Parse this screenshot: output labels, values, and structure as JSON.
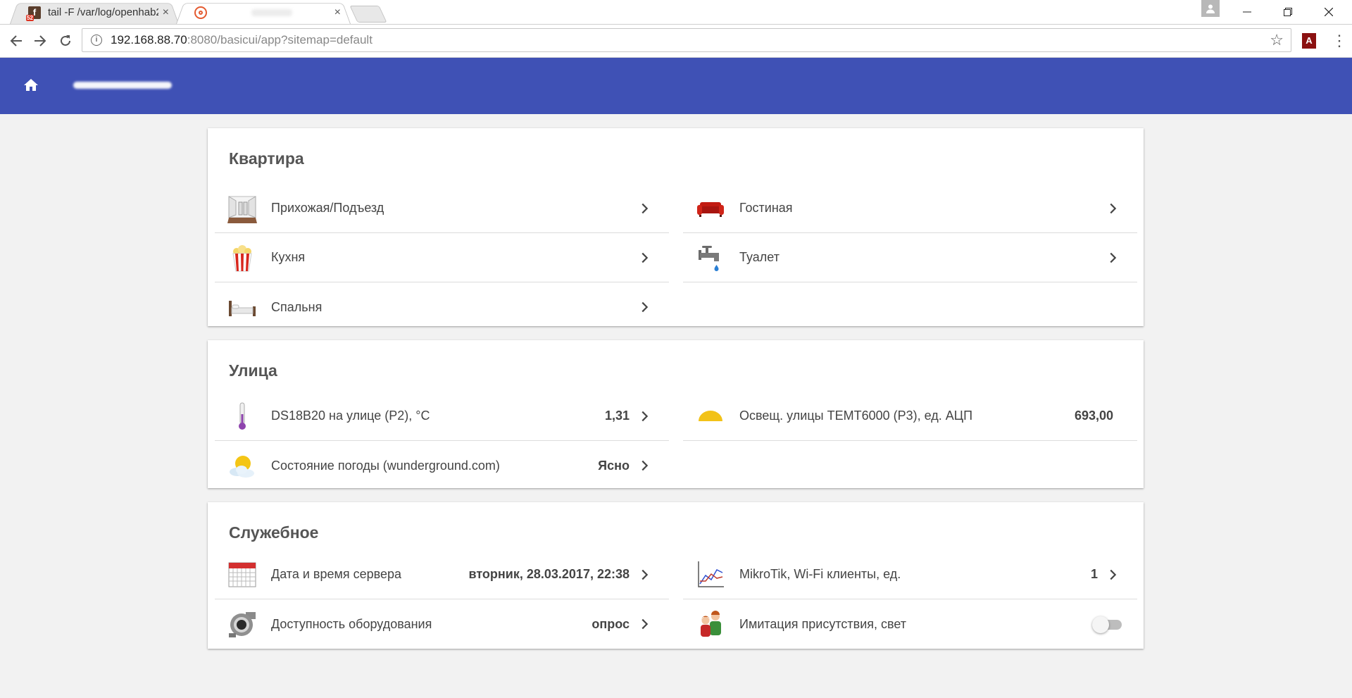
{
  "browser": {
    "tabs": [
      {
        "title": "tail -F /var/log/openhab2",
        "favicon": "terminal-f-icon",
        "close": "×"
      },
      {
        "title": "",
        "favicon": "openhab-icon",
        "close": "×"
      }
    ],
    "profile_icon": "person-icon",
    "window_controls": {
      "minimize": "—",
      "restore": "❐",
      "close": "✕"
    },
    "url": {
      "host": "192.168.88.70",
      "rest": ":8080/basicui/app?sitemap=default"
    },
    "icons": [
      "back-icon",
      "forward-icon",
      "reload-icon",
      "info-icon",
      "star-icon",
      "pdf-icon",
      "menu-icon"
    ]
  },
  "app": {
    "header_color": "#3f51b5",
    "home_icon": "home-icon"
  },
  "sections": [
    {
      "title": "Квартира",
      "items": [
        {
          "label": "Прихожая/Подъезд",
          "icon": "corridor-icon",
          "value": ""
        },
        {
          "label": "Гостиная",
          "icon": "sofa-icon",
          "value": ""
        },
        {
          "label": "Кухня",
          "icon": "popcorn-icon",
          "value": ""
        },
        {
          "label": "Туалет",
          "icon": "faucet-icon",
          "value": ""
        },
        {
          "label": "Спальня",
          "icon": "bed-icon",
          "value": ""
        }
      ]
    },
    {
      "title": "Улица",
      "items": [
        {
          "label": "DS18B20 на улице (P2), °C",
          "icon": "thermometer-icon",
          "value": "1,31"
        },
        {
          "label": "Освещ. улицы TEMT6000 (P3), ед. АЦП",
          "icon": "sun-rise-icon",
          "value": "693,00"
        },
        {
          "label": "Состояние погоды (wunderground.com)",
          "icon": "weather-sun-cloud-icon",
          "value": "Ясно"
        }
      ]
    },
    {
      "title": "Служебное",
      "items": [
        {
          "label": "Дата и время сервера",
          "icon": "calendar-icon",
          "value": "вторник, 28.03.2017, 22:38"
        },
        {
          "label": "MikroTik, Wi-Fi клиенты, ед.",
          "icon": "chart-icon",
          "value": "1"
        },
        {
          "label": "Доступность оборудования",
          "icon": "fan-icon",
          "value": "опрос"
        },
        {
          "label": "Имитация присутствия, свет",
          "icon": "people-icon",
          "value": "",
          "switch_on": false
        }
      ]
    }
  ]
}
